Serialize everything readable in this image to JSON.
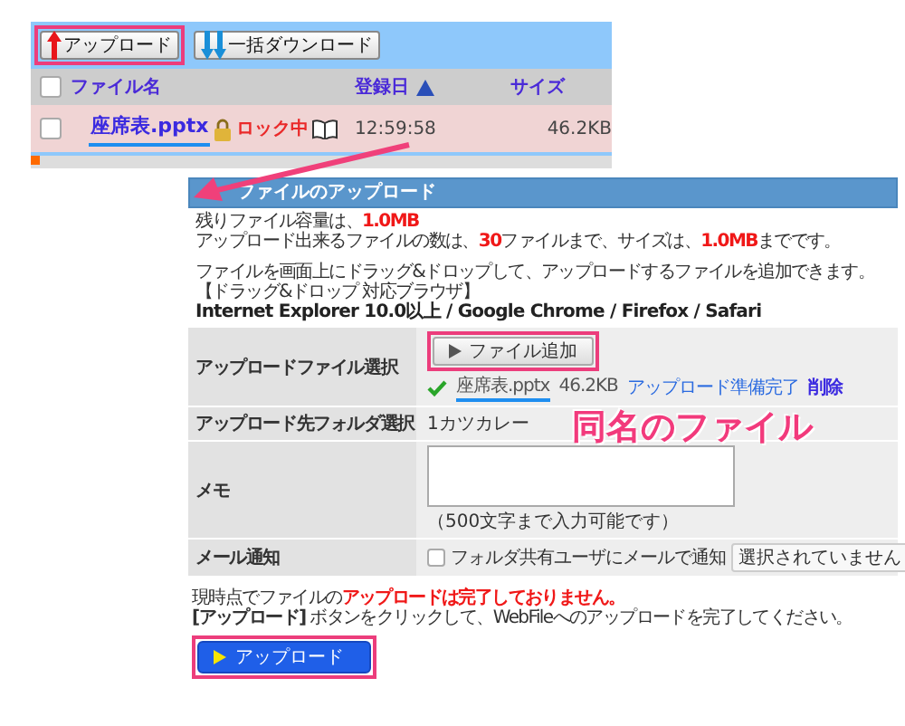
{
  "file_list": {
    "toolbar": [
      {
        "kind": "upload",
        "label": "アップロード",
        "highlighted": true
      },
      {
        "kind": "download",
        "label": "一括ダウンロード",
        "highlighted": false
      }
    ],
    "header_checked": false,
    "columns": [
      {
        "label": "ファイル名",
        "sorted": false
      },
      {
        "label": "登録日",
        "sorted": true
      },
      {
        "label": "サイズ",
        "sorted": false
      }
    ],
    "rows": [
      {
        "checked": false,
        "name": "座席表.pptx",
        "underlined": true,
        "lock": "ロック中",
        "time": "12:59:58",
        "size": "46.2KB"
      }
    ]
  },
  "dialog": {
    "title": "ファイルのアップロード",
    "limits": [
      "残りファイル容量は、**1.0MB**",
      "アップロード出来るファイルの数は、**30**ファイルまで、サイズは、**1.0MB**までです。"
    ],
    "drag_info": [
      "ファイルを画面上にドラッグ&ドロップして、アップロードするファイルを追加できます。",
      "【ドラッグ&ドロップ 対応ブラウザ】"
    ],
    "browsers": "Internet Explorer 10.0以上 / Google Chrome / Firefox / Safari",
    "fields": [
      {
        "kind": "file",
        "label": "アップロードファイル選択",
        "button": "ファイル追加",
        "highlighted": true,
        "file": {
          "name": "座席表.pptx",
          "size": "46.2KB",
          "underlined": true,
          "status": "アップロード準備完了",
          "action": "削除"
        }
      },
      {
        "kind": "text",
        "label": "アップロード先フォルダ選択",
        "value": "1カツカレー"
      },
      {
        "kind": "textarea",
        "label": "メモ",
        "hint": "（500文字まで入力可能です）"
      },
      {
        "kind": "checkbox",
        "label": "メール通知",
        "checked": false,
        "text": "フォルダ共有ユーザにメールで通知",
        "select": "選択されていません"
      }
    ],
    "notice": "現時点でファイルの**アップロードは完了しておりません。**",
    "instruction": "**[アップロード]** ボタンをクリックして、WebFileへのアップロードを完了してください。",
    "submit": {
      "label": "アップロード",
      "highlighted": true
    }
  },
  "callout": "同名のファイル"
}
